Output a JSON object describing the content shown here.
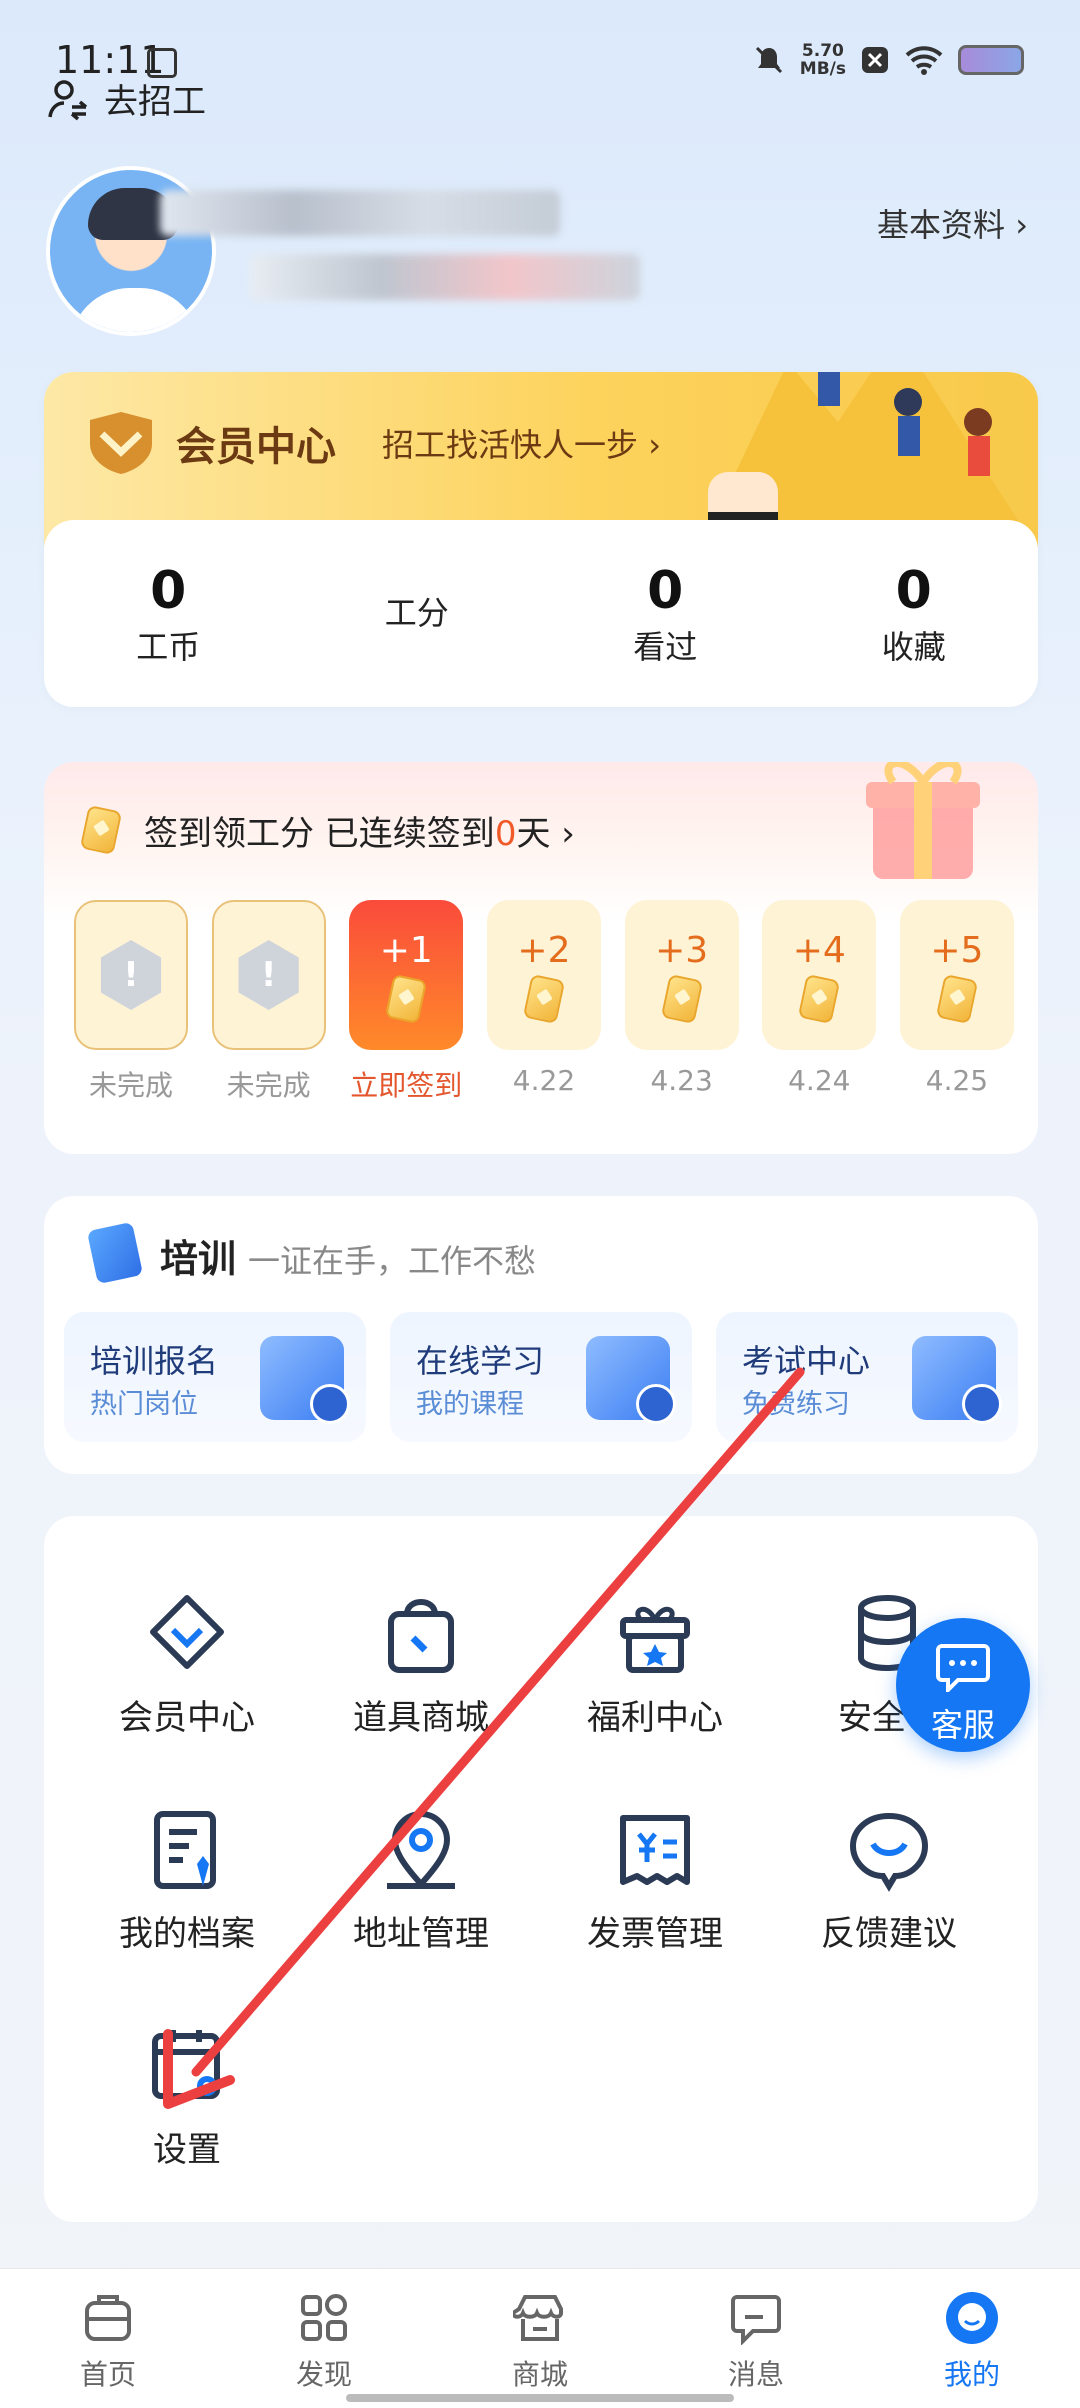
{
  "status_bar": {
    "time": "11:11",
    "speed_value": "5.70",
    "speed_unit": "MB/s"
  },
  "header": {
    "go_recruit": "去招工",
    "basic_info": "基本资料"
  },
  "member": {
    "title": "会员中心",
    "subtitle": "招工找活快人一步"
  },
  "stats": [
    {
      "value": "0",
      "label": "工币"
    },
    {
      "value": "",
      "label": "工分"
    },
    {
      "value": "0",
      "label": "看过"
    },
    {
      "value": "0",
      "label": "收藏"
    }
  ],
  "checkin": {
    "title_prefix": "签到领工分 已连续签到",
    "streak": "0",
    "title_suffix": "天",
    "days": [
      {
        "state": "missed",
        "mark": "!",
        "label": "未完成"
      },
      {
        "state": "missed",
        "mark": "!",
        "label": "未完成"
      },
      {
        "state": "today",
        "reward": "+1",
        "label": "立即签到"
      },
      {
        "state": "future",
        "reward": "+2",
        "label": "4.22"
      },
      {
        "state": "future",
        "reward": "+3",
        "label": "4.23"
      },
      {
        "state": "future",
        "reward": "+4",
        "label": "4.24"
      },
      {
        "state": "future",
        "reward": "+5",
        "label": "4.25"
      }
    ]
  },
  "training": {
    "title": "培训",
    "subtitle": "一证在手，工作不愁",
    "items": [
      {
        "title": "培训报名",
        "subtitle": "热门岗位"
      },
      {
        "title": "在线学习",
        "subtitle": "我的课程"
      },
      {
        "title": "考试中心",
        "subtitle": "免费练习"
      }
    ]
  },
  "tools": [
    {
      "label": "会员中心",
      "icon": "diamond-icon"
    },
    {
      "label": "道具商城",
      "icon": "shopping-bag-icon"
    },
    {
      "label": "福利中心",
      "icon": "gift-icon"
    },
    {
      "label": "安全中",
      "icon": "database-icon"
    },
    {
      "label": "我的档案",
      "icon": "profile-document-icon"
    },
    {
      "label": "地址管理",
      "icon": "location-pin-icon"
    },
    {
      "label": "发票管理",
      "icon": "invoice-icon"
    },
    {
      "label": "反馈建议",
      "icon": "feedback-bubble-icon"
    },
    {
      "label": "设置",
      "icon": "settings-icon"
    }
  ],
  "customer_service": {
    "label": "客服"
  },
  "bottom_nav": [
    {
      "label": "首页",
      "icon": "home-icon"
    },
    {
      "label": "发现",
      "icon": "grid-icon"
    },
    {
      "label": "商城",
      "icon": "store-icon"
    },
    {
      "label": "消息",
      "icon": "message-icon"
    },
    {
      "label": "我的",
      "icon": "profile-icon",
      "active": true
    }
  ],
  "colors": {
    "accent": "#1577f3",
    "checkin_red": "#f05a28",
    "member_brown": "#6b3a12",
    "arrow": "#ec3f3f"
  }
}
